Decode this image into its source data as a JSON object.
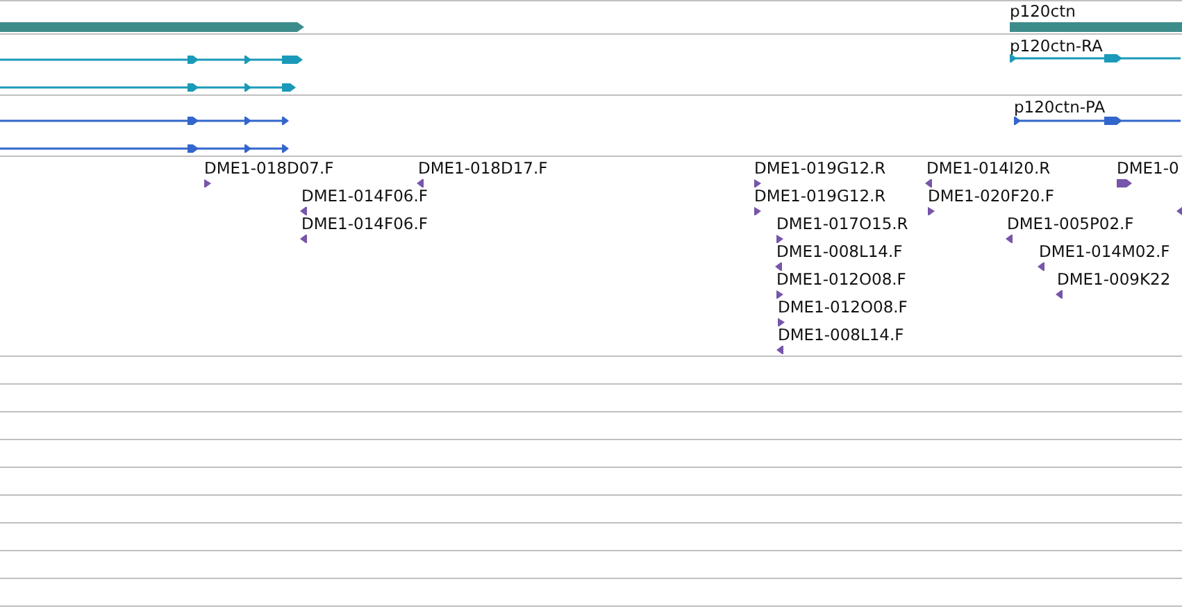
{
  "gene_track": {
    "features": [
      {
        "reverse": false
      },
      {
        "label": "p120ctn"
      }
    ]
  },
  "transcript_tracks": [
    {
      "kind": "rna",
      "transcripts": [
        {
          "reverse": false
        },
        {
          "reverse": false
        },
        {
          "label": "p120ctn-RA",
          "reverse": false
        }
      ]
    },
    {
      "kind": "protein",
      "transcripts": [
        {
          "reverse": false
        },
        {
          "reverse": false
        },
        {
          "label": "p120ctn-PA",
          "reverse": false
        }
      ]
    }
  ],
  "est_track": {
    "features": [
      {
        "label": "DME1-018D07.F",
        "reverse": false
      },
      {
        "label": "DME1-018D17.F",
        "reverse": true
      },
      {
        "label": "DME1-019G12.R",
        "reverse": false
      },
      {
        "label": "DME1-014I20.R",
        "reverse": true
      },
      {
        "label": "DME1-0",
        "reverse": false
      },
      {
        "label": "DME1-014F06.F",
        "reverse": true
      },
      {
        "label": "DME1-019G12.R",
        "reverse": false
      },
      {
        "label": "DME1-020F20.F",
        "reverse": false
      },
      {
        "reverse": true
      },
      {
        "label": "DME1-014F06.F",
        "reverse": true
      },
      {
        "label": "DME1-017O15.R",
        "reverse": false
      },
      {
        "label": "DME1-005P02.F",
        "reverse": true
      },
      {
        "label": "DME1-008L14.F",
        "reverse": true
      },
      {
        "label": "DME1-014M02.F",
        "reverse": true
      },
      {
        "label": "DME1-012O08.F",
        "reverse": false
      },
      {
        "label": "DME1-009K22",
        "reverse": true
      },
      {
        "label": "DME1-012O08.F",
        "reverse": false
      },
      {
        "label": "DME1-008L14.F",
        "reverse": true
      }
    ]
  }
}
